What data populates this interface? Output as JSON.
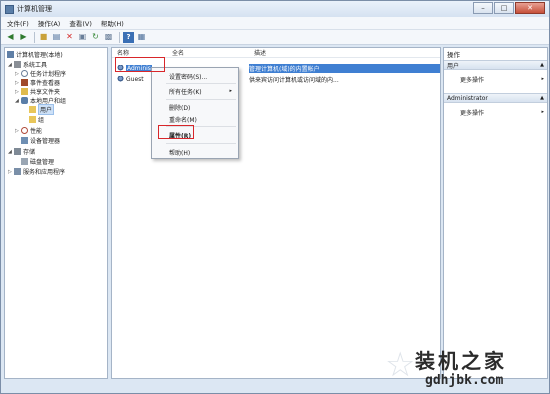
{
  "window": {
    "title": "计算机管理",
    "controls": {
      "minimize": "–",
      "maximize": "□",
      "close": "✕"
    }
  },
  "menubar": {
    "items": [
      "文件(F)",
      "操作(A)",
      "查看(V)",
      "帮助(H)"
    ]
  },
  "toolbar": {
    "icons": [
      "back-arrow-icon",
      "forward-arrow-icon",
      "up-folder-icon",
      "show-tree-icon",
      "delete-icon",
      "properties-icon",
      "refresh-icon",
      "export-icon",
      "help-icon",
      "console-icon"
    ]
  },
  "tree": {
    "root": "计算机管理(本地)",
    "items": [
      {
        "label": "系统工具",
        "level": 1
      },
      {
        "label": "任务计划程序",
        "level": 2
      },
      {
        "label": "事件查看器",
        "level": 2
      },
      {
        "label": "共享文件夹",
        "level": 2
      },
      {
        "label": "本地用户和组",
        "level": 2
      },
      {
        "label": "用户",
        "level": 3,
        "selected": true
      },
      {
        "label": "组",
        "level": 3
      },
      {
        "label": "性能",
        "level": 2
      },
      {
        "label": "设备管理器",
        "level": 2
      },
      {
        "label": "存储",
        "level": 1
      },
      {
        "label": "磁盘管理",
        "level": 2
      },
      {
        "label": "服务和应用程序",
        "level": 1
      }
    ]
  },
  "list": {
    "headers": [
      "名称",
      "全名",
      "描述"
    ],
    "rows": [
      {
        "name": "Adminis",
        "fullname": "",
        "description": "管理计算机(域)的内置帐户"
      },
      {
        "name": "Guest",
        "fullname": "",
        "description": "供来宾访问计算机或访问域的内..."
      }
    ]
  },
  "context_menu": {
    "items": [
      "设置密码(S)...",
      "所有任务(K)",
      "删除(D)",
      "重命名(M)",
      "属性(R)",
      "帮助(H)"
    ],
    "submenu_arrow": "▸"
  },
  "actions": {
    "title": "操作",
    "sections": [
      {
        "label": "用户",
        "items": [
          "更多操作"
        ]
      },
      {
        "label": "Administrator",
        "items": [
          "更多操作"
        ]
      }
    ],
    "arrow": "▸"
  },
  "watermark": {
    "brand": "装机之家",
    "url": "gdhjbk.com"
  },
  "colors": {
    "selection": "#3f7fd2",
    "highlight_box": "#d8262a",
    "pane_bg": "#dce7f3"
  }
}
